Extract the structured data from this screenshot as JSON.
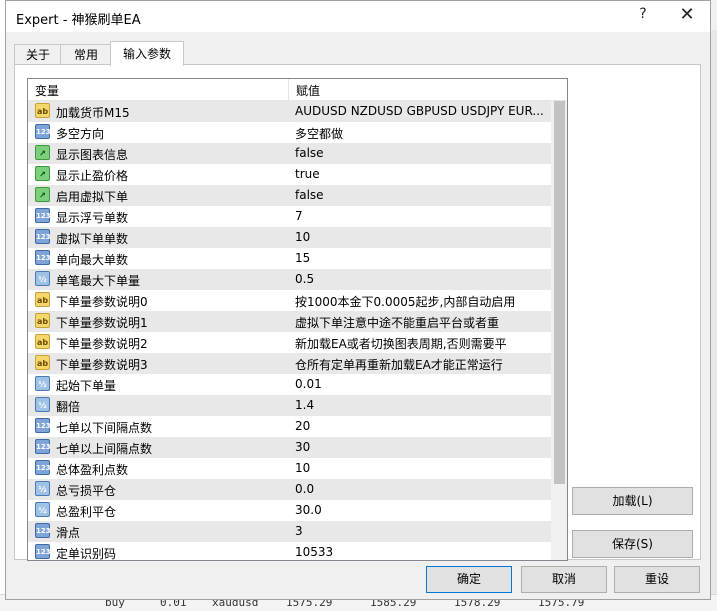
{
  "window": {
    "title": "Expert - 神猴刷单EA",
    "help_glyph": "?",
    "close_glyph": "✕"
  },
  "tabs": [
    {
      "label": "关于",
      "active": false
    },
    {
      "label": "常用",
      "active": false
    },
    {
      "label": "输入参数",
      "active": true
    }
  ],
  "table": {
    "columns": [
      "变量",
      "赋值"
    ],
    "rows": [
      {
        "icon": "ab",
        "name": "加载货币M15",
        "value": "AUDUSD NZDUSD GBPUSD USDJPY EUR..."
      },
      {
        "icon": "123",
        "name": "多空方向",
        "value": "多空都做"
      },
      {
        "icon": "bool",
        "name": "显示图表信息",
        "value": "false"
      },
      {
        "icon": "bool",
        "name": "显示止盈价格",
        "value": "true"
      },
      {
        "icon": "bool",
        "name": "启用虚拟下单",
        "value": "false"
      },
      {
        "icon": "123",
        "name": "显示浮亏单数",
        "value": "7"
      },
      {
        "icon": "123",
        "name": "虚拟下单单数",
        "value": "10"
      },
      {
        "icon": "123",
        "name": "单向最大单数",
        "value": "15"
      },
      {
        "icon": "v2",
        "name": "单笔最大下单量",
        "value": "0.5"
      },
      {
        "icon": "ab",
        "name": "下单量参数说明0",
        "value": "按1000本金下0.0005起步,内部自动启用"
      },
      {
        "icon": "ab",
        "name": "下单量参数说明1",
        "value": "虚拟下单注意中途不能重启平台或者重"
      },
      {
        "icon": "ab",
        "name": "下单量参数说明2",
        "value": "新加载EA或者切换图表周期,否则需要平"
      },
      {
        "icon": "ab",
        "name": "下单量参数说明3",
        "value": "仓所有定单再重新加载EA才能正常运行"
      },
      {
        "icon": "v2",
        "name": "起始下单量",
        "value": "0.01"
      },
      {
        "icon": "v2",
        "name": "翻倍",
        "value": "1.4"
      },
      {
        "icon": "123",
        "name": "七单以下间隔点数",
        "value": "20"
      },
      {
        "icon": "123",
        "name": "七单以上间隔点数",
        "value": "30"
      },
      {
        "icon": "123",
        "name": "总体盈利点数",
        "value": "10"
      },
      {
        "icon": "v2",
        "name": "总亏损平仓",
        "value": "0.0"
      },
      {
        "icon": "v2",
        "name": "总盈利平仓",
        "value": "30.0"
      },
      {
        "icon": "123",
        "name": "滑点",
        "value": "3"
      },
      {
        "icon": "123",
        "name": "定单识别码",
        "value": "10533"
      }
    ]
  },
  "icon_glyphs": {
    "ab": "ab",
    "123": "123",
    "bool": "↗",
    "v2": "½"
  },
  "buttons": {
    "load": "加载(L)",
    "save": "保存(S)",
    "ok": "确定",
    "cancel": "取消",
    "reset": "重设"
  },
  "background": {
    "bottom_fragments": [
      "buy",
      "0.01",
      "xaudusd",
      "1575.29",
      "1585.29",
      "1578.29",
      "1575.79"
    ]
  },
  "colors": {
    "default_button_border": "#0078d7",
    "row_alt": "#e8e8e8"
  }
}
